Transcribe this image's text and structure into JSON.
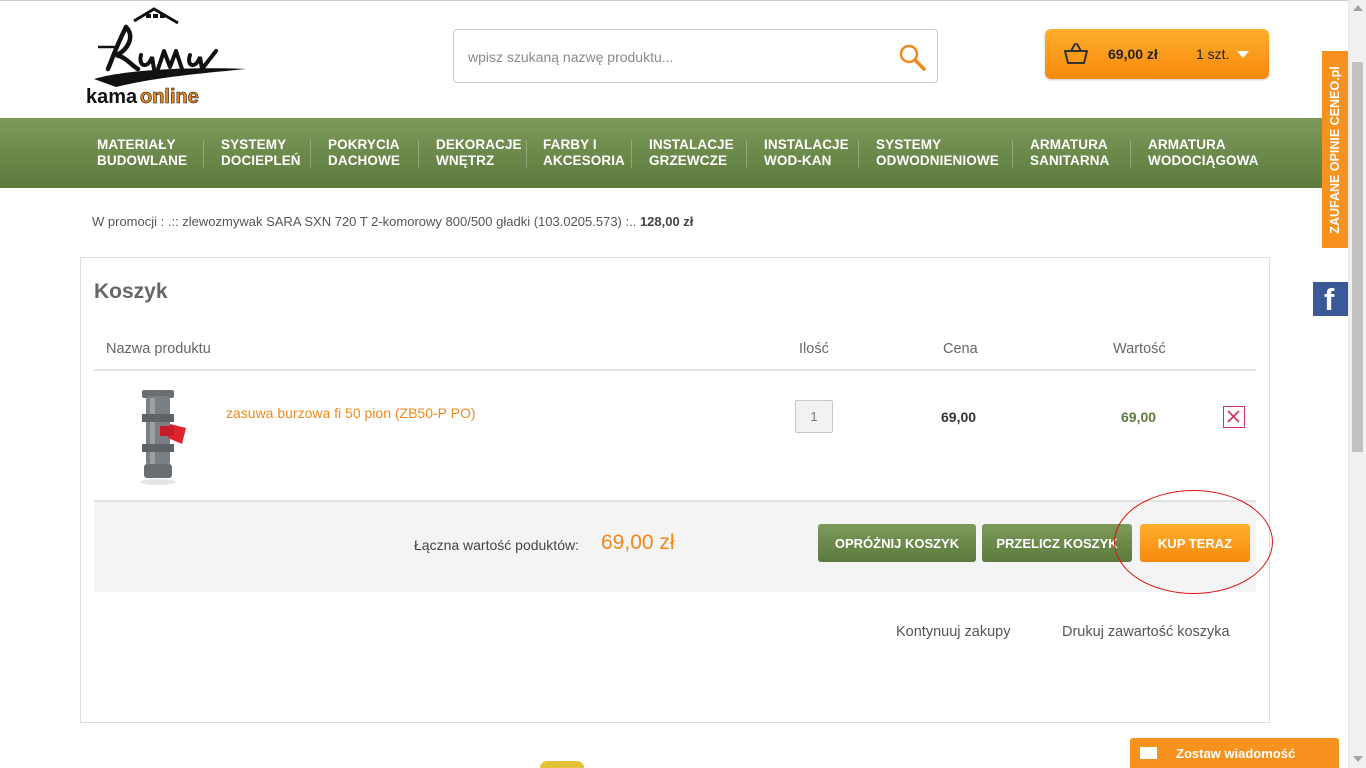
{
  "header": {
    "logo_top": "Kama",
    "logo_bottom": "kamaonline",
    "search_placeholder": "wpisz szukaną nazwę produktu...",
    "cart_total": "69,00 zł",
    "cart_qty": "1 szt."
  },
  "nav": {
    "items": [
      {
        "line1": "MATERIAŁY",
        "line2": "BUDOWLANE"
      },
      {
        "line1": "SYSTEMY",
        "line2": "DOCIEPLEŃ"
      },
      {
        "line1": "POKRYCIA",
        "line2": "DACHOWE"
      },
      {
        "line1": "DEKORACJE",
        "line2": "WNĘTRZ"
      },
      {
        "line1": "FARBY I",
        "line2": "AKCESORIA"
      },
      {
        "line1": "INSTALACJE",
        "line2": "GRZEWCZE"
      },
      {
        "line1": "INSTALACJE",
        "line2": "WOD-KAN"
      },
      {
        "line1": "SYSTEMY",
        "line2": "ODWODNIENIOWE"
      },
      {
        "line1": "ARMATURA",
        "line2": "SANITARNA"
      },
      {
        "line1": "ARMATURA",
        "line2": "WODOCIĄGOWA"
      }
    ]
  },
  "promo": {
    "text": "W promocji : .:: zlewozmywak SARA SXN 720 T 2-komorowy 800/500 gładki (103.0205.573) :.. ",
    "price": "128,00 zł"
  },
  "cart": {
    "title": "Koszyk",
    "columns": {
      "name": "Nazwa produktu",
      "qty": "Ilość",
      "price": "Cena",
      "value": "Wartość"
    },
    "items": [
      {
        "name": "zasuwa burzowa fi 50 pion (ZB50-P PO)",
        "qty": "1",
        "price": "69,00",
        "value": "69,00"
      }
    ],
    "total_label": "Łączna wartość poduktów:",
    "total_value": "69,00 zł",
    "buttons": {
      "empty": "OPRÓŻNIJ KOSZYK",
      "recalc": "PRZELICZ KOSZYK",
      "buy": "KUP TERAZ"
    },
    "links": {
      "continue": "Kontynuuj zakupy",
      "print": "Drukuj zawartość koszyka"
    }
  },
  "widgets": {
    "ceneo": "ZAUFANE OPINIE CENEO.pl",
    "facebook": "f",
    "message": "Zostaw wiadomość"
  },
  "colors": {
    "accent_orange": "#f7890b",
    "nav_green": "#5d7a3e",
    "annotation_red": "#dd1111"
  }
}
